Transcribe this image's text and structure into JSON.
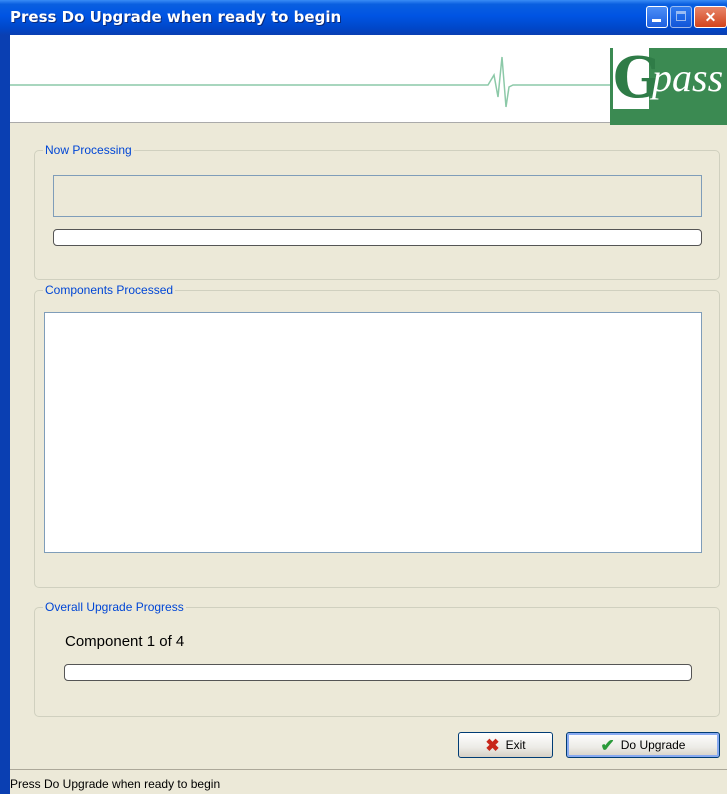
{
  "window": {
    "title": "Press Do Upgrade when ready to begin",
    "controls": {
      "minimize": "minimize-icon",
      "maximize": "maximize-icon",
      "close": "close-icon",
      "close_glyph": "✕"
    }
  },
  "banner": {
    "logo_initial": "G",
    "logo_text": "pass"
  },
  "now_processing": {
    "legend": "Now Processing",
    "current_item": "",
    "progress": 0
  },
  "components_processed": {
    "legend": "Components Processed",
    "items": []
  },
  "overall": {
    "legend": "Overall Upgrade Progress",
    "count_text": "Component 1 of  4",
    "progress": 0
  },
  "buttons": {
    "exit_label": "Exit",
    "exit_icon": "✖",
    "upgrade_label": "Do Upgrade",
    "upgrade_icon": "✔"
  },
  "colors": {
    "legend": "#0046d5",
    "exit_icon": "#c8261a",
    "upgrade_icon": "#2a9a3a",
    "logo_bg": "#3b8a52"
  },
  "status": {
    "text": "Press Do Upgrade when ready to begin"
  }
}
